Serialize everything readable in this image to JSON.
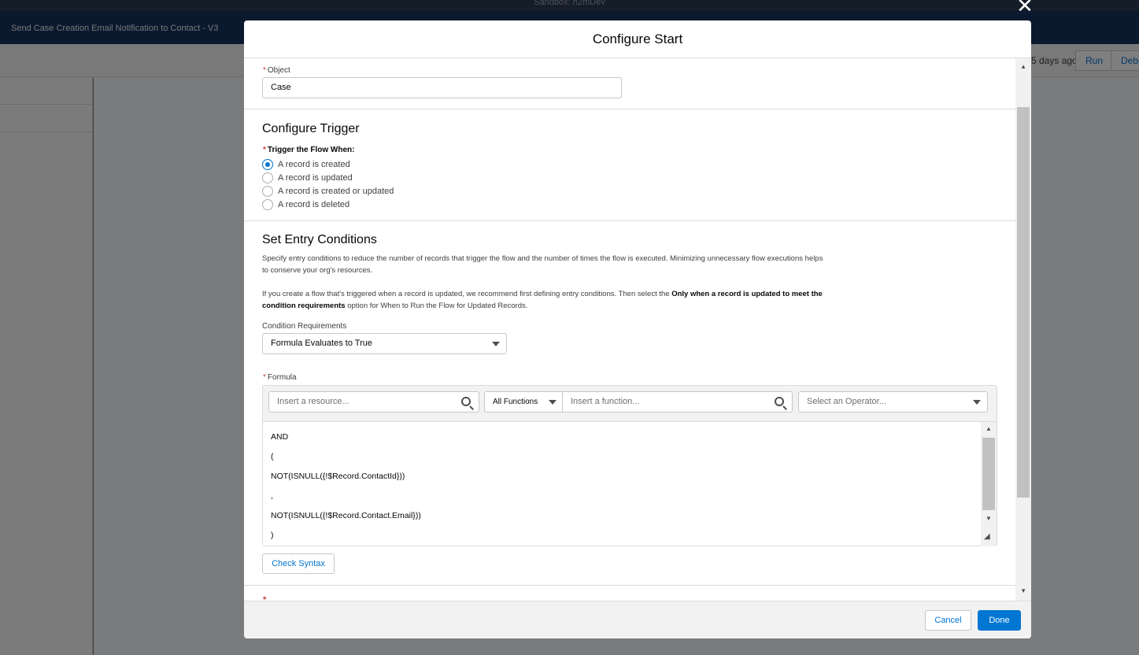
{
  "background": {
    "sandbox_label": "Sandbox: h2mDev",
    "flow_title": "Send Case Creation Email Notification to Contact - V3",
    "saved_text": "5 days ago",
    "run_label": "Run",
    "debug_label": "Debu"
  },
  "modal": {
    "title": "Configure Start",
    "object": {
      "label": "Object",
      "value": "Case"
    },
    "trigger": {
      "heading": "Configure Trigger",
      "label": "Trigger the Flow When:",
      "options": [
        {
          "label": "A record is created",
          "selected": true
        },
        {
          "label": "A record is updated",
          "selected": false
        },
        {
          "label": "A record is created or updated",
          "selected": false
        },
        {
          "label": "A record is deleted",
          "selected": false
        }
      ]
    },
    "entry": {
      "heading": "Set Entry Conditions",
      "desc1": "Specify entry conditions to reduce the number of records that trigger the flow and the number of times the flow is executed. Minimizing unnecessary flow executions helps to conserve your org's resources.",
      "desc2_a": "If you create a flow that's triggered when a record is updated, we recommend first defining entry conditions. Then select the ",
      "desc2_b": "Only when a record is updated to meet the condition requirements",
      "desc2_c": " option for When to Run the Flow for Updated Records.",
      "condition_label": "Condition Requirements",
      "condition_value": "Formula Evaluates to True",
      "formula_label": "Formula",
      "resource_placeholder": "Insert a resource...",
      "functions_filter": "All Functions",
      "function_placeholder": "Insert a function...",
      "operator_placeholder": "Select an Operator...",
      "formula_lines": [
        "AND",
        "(",
        "NOT(ISNULL({!$Record.ContactId}))",
        ",",
        "NOT(ISNULL({!$Record.Contact.Email}))",
        ")"
      ],
      "check_syntax": "Check Syntax"
    },
    "cancel": "Cancel",
    "done": "Done"
  },
  "colors": {
    "brand": "#0176d3",
    "header_bg": "#16325c",
    "required": "#c23934"
  }
}
